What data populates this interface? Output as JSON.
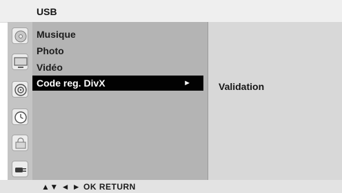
{
  "header": {
    "title": "USB"
  },
  "sidebar_icons": [
    "disc-icon",
    "screen-icon",
    "speaker-icon",
    "clock-icon",
    "lock-icon",
    "plug-icon"
  ],
  "menu": {
    "items": [
      {
        "label": "Musique",
        "selected": false
      },
      {
        "label": "Photo",
        "selected": false
      },
      {
        "label": "Vidéo",
        "selected": false
      },
      {
        "label": "Code reg. DivX",
        "selected": true,
        "arrow": "►"
      }
    ]
  },
  "submenu": {
    "item": "Validation"
  },
  "footer": {
    "hint": "▲▼  ◄ ►  OK  RETURN"
  },
  "colors": {
    "selected_bg": "#020202",
    "menu_bg": "#b4b4b4",
    "submenu_bg": "#d8d8d8"
  }
}
